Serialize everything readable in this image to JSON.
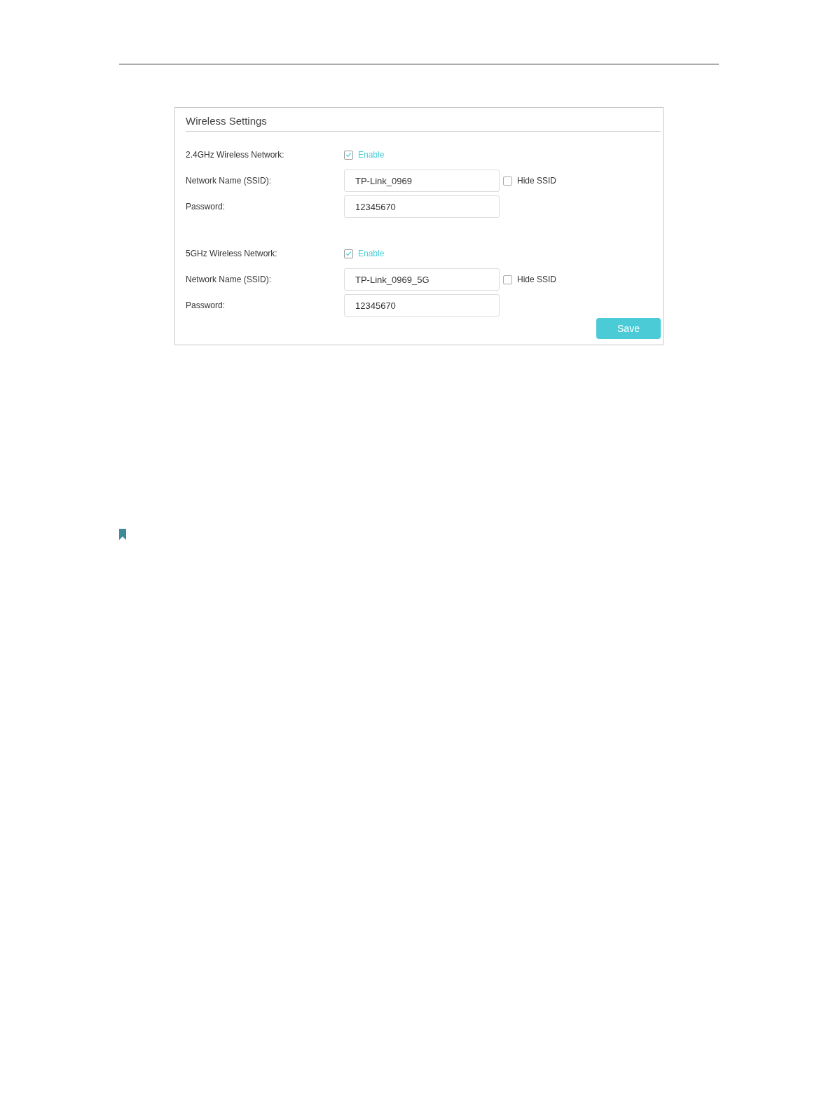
{
  "panel": {
    "title": "Wireless Settings",
    "networks": [
      {
        "label": "2.4GHz Wireless Network:",
        "enable": {
          "label": "Enable",
          "checked": true
        },
        "ssid_label": "Network Name (SSID):",
        "ssid": "TP-Link_0969",
        "hide_ssid": {
          "label": "Hide SSID",
          "checked": false
        },
        "password_label": "Password:",
        "password": "12345670"
      },
      {
        "label": "5GHz Wireless Network:",
        "enable": {
          "label": "Enable",
          "checked": true
        },
        "ssid_label": "Network Name (SSID):",
        "ssid": "TP-Link_0969_5G",
        "hide_ssid": {
          "label": "Hide SSID",
          "checked": false
        },
        "password_label": "Password:",
        "password": "12345670"
      }
    ],
    "save_button": "Save"
  }
}
